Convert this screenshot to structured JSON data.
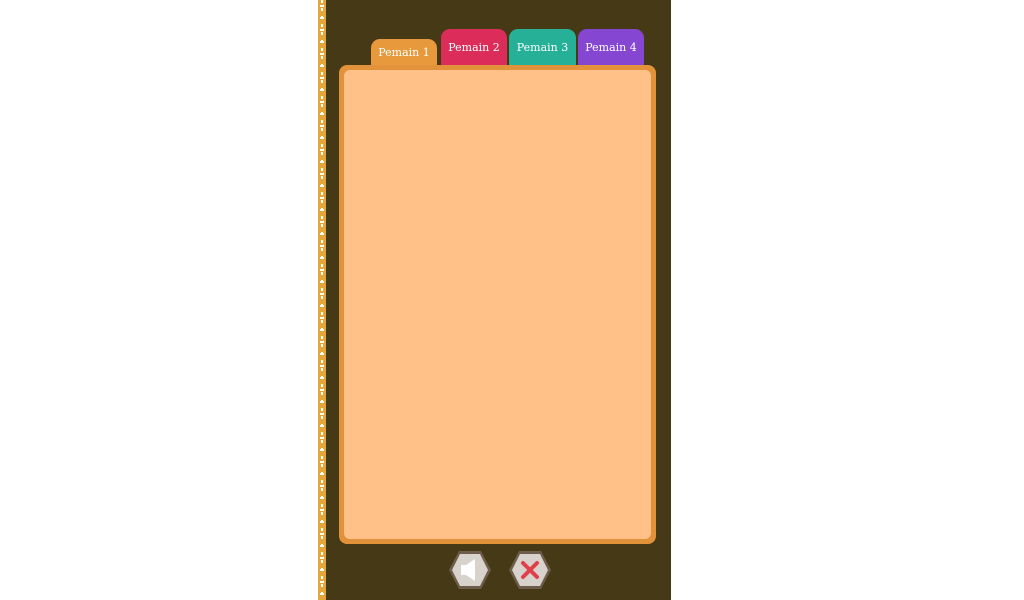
{
  "tabs": [
    {
      "label": "Pemain 1",
      "color": "#e8993c"
    },
    {
      "label": "Pemain 2",
      "color": "#dc2c5a"
    },
    {
      "label": "Pemain 3",
      "color": "#26b097"
    },
    {
      "label": "Pemain 4",
      "color": "#8546d2"
    }
  ],
  "controls": {
    "sound_icon": "speaker-icon",
    "close_icon": "close-icon"
  },
  "colors": {
    "panel_background": "#453916",
    "card_border": "#e2923a",
    "card_fill": "#ffc188",
    "chain": "#e3a63a"
  }
}
